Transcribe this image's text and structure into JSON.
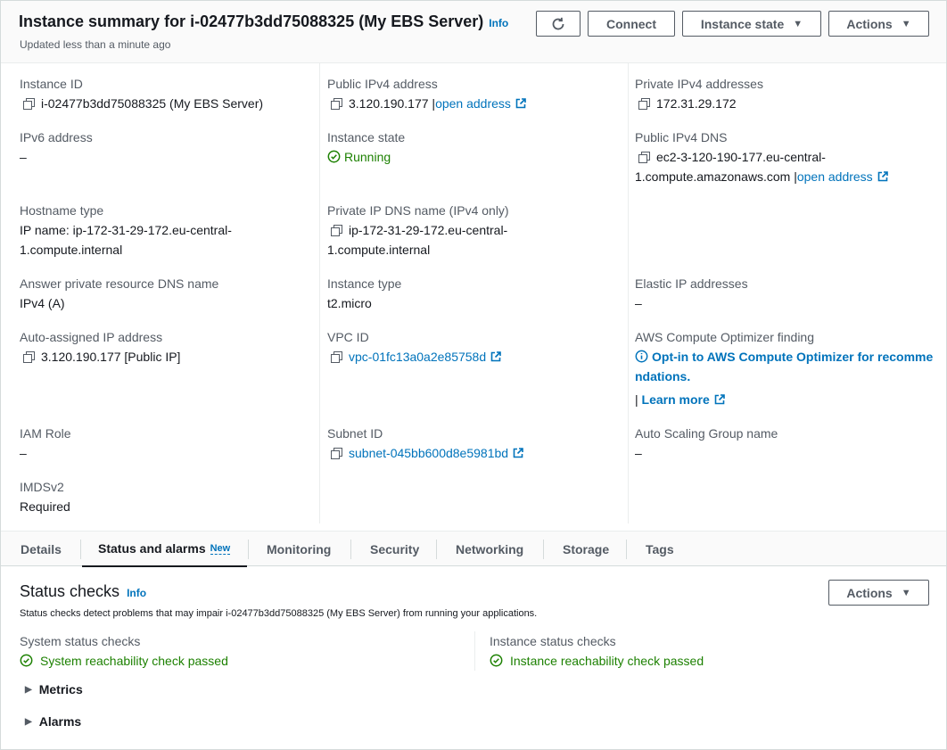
{
  "header": {
    "title": "Instance summary for i-02477b3dd75088325 (My EBS Server)",
    "info_label": "Info",
    "subtitle": "Updated less than a minute ago",
    "connect_label": "Connect",
    "instance_state_label": "Instance state",
    "actions_label": "Actions"
  },
  "details": {
    "instance_id": {
      "label": "Instance ID",
      "value": "i-02477b3dd75088325 (My EBS Server)"
    },
    "ipv6": {
      "label": "IPv6 address",
      "value": "–"
    },
    "hostname_type": {
      "label": "Hostname type",
      "value_line1": "IP name: ip-172-31-29-172.eu-central-",
      "value_line2": "1.compute.internal"
    },
    "answer_dns": {
      "label": "Answer private resource DNS name",
      "value": "IPv4 (A)"
    },
    "auto_ip": {
      "label": "Auto-assigned IP address",
      "value": "3.120.190.177 [Public IP]"
    },
    "iam_role": {
      "label": "IAM Role",
      "value": "–"
    },
    "imdsv2": {
      "label": "IMDSv2",
      "value": "Required"
    },
    "public_ipv4": {
      "label": "Public IPv4 address",
      "value": "3.120.190.177 |",
      "link": "open address"
    },
    "instance_state": {
      "label": "Instance state",
      "value": "Running"
    },
    "private_dns": {
      "label": "Private IP DNS name (IPv4 only)",
      "value_line1": "ip-172-31-29-172.eu-central-",
      "value_line2": "1.compute.internal"
    },
    "instance_type": {
      "label": "Instance type",
      "value": "t2.micro"
    },
    "vpc_id": {
      "label": "VPC ID",
      "value": "vpc-01fc13a0a2e85758d"
    },
    "subnet_id": {
      "label": "Subnet ID",
      "value": "subnet-045bb600d8e5981bd"
    },
    "private_ipv4": {
      "label": "Private IPv4 addresses",
      "value": "172.31.29.172"
    },
    "public_dns": {
      "label": "Public IPv4 DNS",
      "value_line1": "ec2-3-120-190-177.eu-central-",
      "value_line2": "1.compute.amazonaws.com |",
      "link": "open address"
    },
    "elastic_ip": {
      "label": "Elastic IP addresses",
      "value": "–"
    },
    "optimizer": {
      "label": "AWS Compute Optimizer finding",
      "link_line1": "Opt-in to AWS Compute Optimizer for recomme",
      "link_line2": "ndations.",
      "sep": "|",
      "learn_more": "Learn more"
    },
    "asg": {
      "label": "Auto Scaling Group name",
      "value": "–"
    }
  },
  "tabs": [
    {
      "label": "Details"
    },
    {
      "label": "Status and alarms",
      "badge": "New"
    },
    {
      "label": "Monitoring"
    },
    {
      "label": "Security"
    },
    {
      "label": "Networking"
    },
    {
      "label": "Storage"
    },
    {
      "label": "Tags"
    }
  ],
  "status_checks": {
    "title": "Status checks",
    "info_label": "Info",
    "description": "Status checks detect problems that may impair i-02477b3dd75088325 (My EBS Server) from running your applications.",
    "actions_label": "Actions",
    "system": {
      "label": "System status checks",
      "value": "System reachability check passed"
    },
    "instance": {
      "label": "Instance status checks",
      "value": "Instance reachability check passed"
    },
    "metrics_label": "Metrics",
    "alarms_label": "Alarms"
  },
  "colors": {
    "link": "#0073bb",
    "success": "#1d8102",
    "text": "#16191f",
    "muted": "#545b64"
  },
  "icons": [
    "refresh-icon",
    "copy-icon",
    "external-link-icon",
    "check-circle-icon",
    "info-circle-icon",
    "caret-down-icon",
    "caret-right-icon"
  ]
}
